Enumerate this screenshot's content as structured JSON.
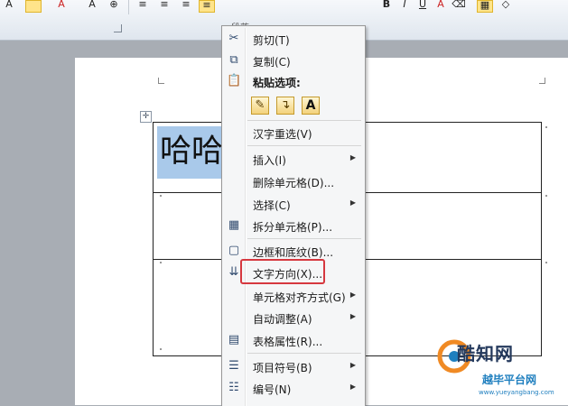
{
  "context_menu": {
    "items": [
      {
        "label": "剪切(T)",
        "icon": "scissors-icon",
        "glyph": "✂"
      },
      {
        "label": "复制(C)",
        "icon": "copy-icon",
        "glyph": "⧉"
      },
      {
        "label": "粘贴选项:",
        "icon": "clipboard-icon",
        "glyph": "📋"
      },
      {
        "label": "汉字重选(V)"
      },
      {
        "label": "插入(I)",
        "submenu": "▶"
      },
      {
        "label": "删除单元格(D)..."
      },
      {
        "label": "选择(C)",
        "submenu": "▶"
      },
      {
        "label": "拆分单元格(P)...",
        "icon": "split-cells-icon",
        "glyph": "▦"
      },
      {
        "label": "边框和底纹(B)...",
        "icon": "borders-icon",
        "glyph": "▢"
      },
      {
        "label": "文字方向(X)...",
        "icon": "text-direction-icon",
        "glyph": "⇊"
      },
      {
        "label": "单元格对齐方式(G)",
        "submenu": "▶"
      },
      {
        "label": "自动调整(A)",
        "submenu": "▶"
      },
      {
        "label": "表格属性(R)...",
        "icon": "table-properties-icon",
        "glyph": "▤"
      },
      {
        "label": "项目符号(B)",
        "icon": "bullets-icon",
        "glyph": "☰",
        "submenu": "▶"
      },
      {
        "label": "编号(N)",
        "icon": "numbering-icon",
        "glyph": "☷",
        "submenu": "▶"
      }
    ],
    "paste_options": [
      "✎",
      "↴",
      "A"
    ]
  },
  "document": {
    "cell_text": "哈哈"
  },
  "ribbon": {
    "font_glyphs": [
      "A",
      "A",
      "A",
      "⊕"
    ],
    "para_glyphs": [
      "≡",
      "≡",
      "≡",
      "≡",
      "B",
      "I",
      "U",
      "A",
      "⌫",
      "▦",
      "◇"
    ],
    "group_label": "段落"
  },
  "watermark": {
    "name": "酷知网",
    "subtitle": "越毕平台网",
    "url": "www.yueyangbang.com"
  },
  "colors": {
    "highlight": "#d6383f",
    "selection": "#a9c9ea"
  }
}
